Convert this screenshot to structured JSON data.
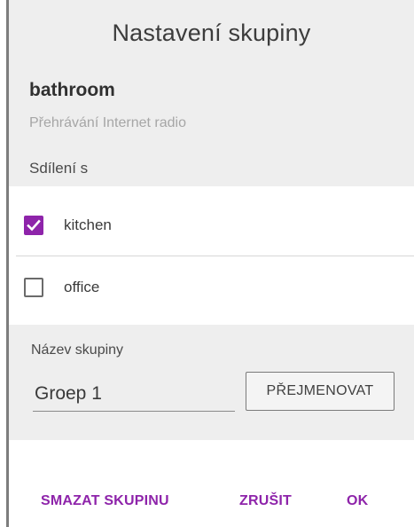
{
  "dialog": {
    "title": "Nastavení skupiny",
    "group_name": "bathroom",
    "playing_status": "Přehrávání Internet radio",
    "share_label": "Sdílení s"
  },
  "share_targets": [
    {
      "label": "kitchen",
      "checked": true
    },
    {
      "label": "office",
      "checked": false
    }
  ],
  "name_section": {
    "label": "Název skupiny",
    "input_value": "Groep 1",
    "rename_button": "PŘEJMENOVAT"
  },
  "actions": {
    "delete": "SMAZAT SKUPINU",
    "cancel": "ZRUŠIT",
    "ok": "OK"
  },
  "colors": {
    "accent": "#8e24aa",
    "header_bg": "#eeeeee"
  }
}
